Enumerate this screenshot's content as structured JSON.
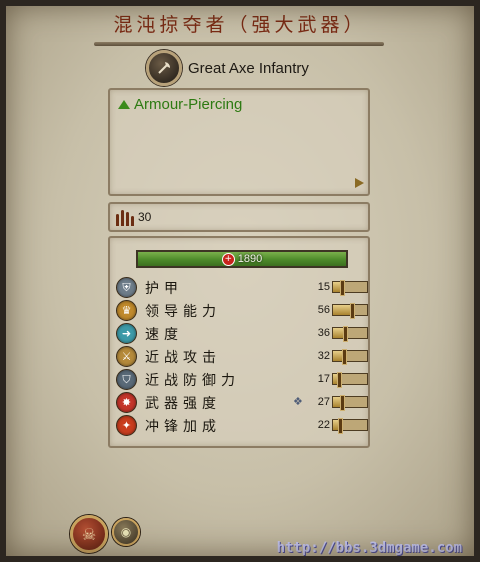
{
  "title": "混沌掠夺者（强大武器）",
  "unit": {
    "name": "Great Axe Infantry",
    "icon": "axe-icon"
  },
  "abilities": [
    {
      "label": "Armour-Piercing",
      "icon": "green-up-triangle-icon"
    }
  ],
  "unit_count": "30",
  "health": "1890",
  "stats": [
    {
      "label": "护甲",
      "value": "15",
      "fraction": 0.25,
      "icon": "armour-icon",
      "color": "#6e7d8a"
    },
    {
      "label": "领导能力",
      "value": "56",
      "fraction": 0.55,
      "icon": "leadership-icon",
      "color": "#c08a2c"
    },
    {
      "label": "速度",
      "value": "36",
      "fraction": 0.35,
      "icon": "speed-icon",
      "color": "#3d9aa8"
    },
    {
      "label": "近战攻击",
      "value": "32",
      "fraction": 0.32,
      "icon": "melee-attack-icon",
      "color": "#b58a3a"
    },
    {
      "label": "近战防御力",
      "value": "17",
      "fraction": 0.17,
      "icon": "melee-defence-icon",
      "color": "#5a6a78"
    },
    {
      "label": "武器强度",
      "value": "27",
      "fraction": 0.27,
      "icon": "weapon-strength-icon",
      "color": "#c4352a",
      "bonus_icon": "armour-piercing-icon"
    },
    {
      "label": "冲锋加成",
      "value": "22",
      "fraction": 0.22,
      "icon": "charge-bonus-icon",
      "color": "#c93d1e"
    }
  ],
  "watermark": "http://bbs.3dmgame.com"
}
